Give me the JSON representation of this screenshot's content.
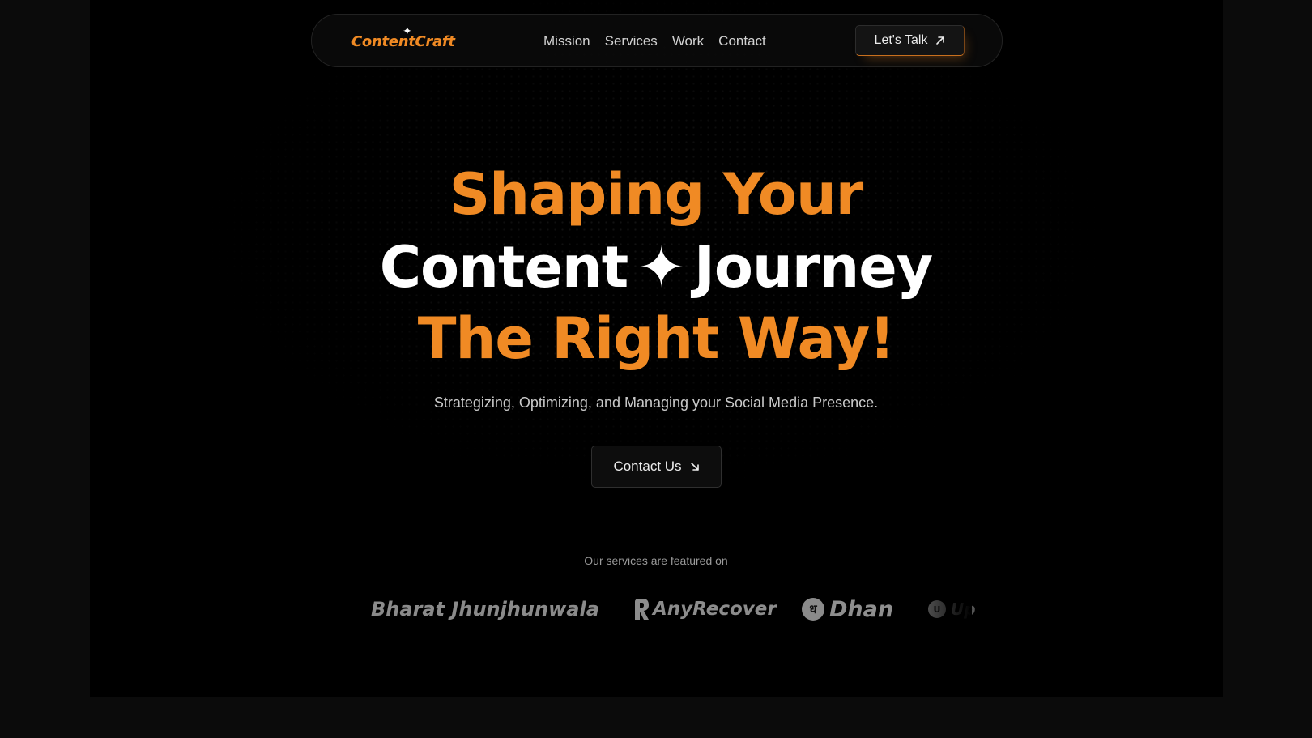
{
  "nav": {
    "logo": "ContentCraft",
    "links": [
      "Mission",
      "Services",
      "Work",
      "Contact"
    ],
    "cta_label": "Let's Talk"
  },
  "hero": {
    "line1": "Shaping Your",
    "line2_left": "Content",
    "line2_sparkle": "✦",
    "line2_right": "Journey",
    "line3": "The Right Way!",
    "subtitle": "Strategizing, Optimizing, and Managing your Social Media Presence.",
    "cta_label": "Contact Us"
  },
  "featured": {
    "label": "Our services are featured on",
    "brands": [
      "Bharat Jhunjhunwala",
      "AnyRecover",
      "Dhan",
      "Up"
    ],
    "dhan_icon_text": "ध",
    "up_icon_text": "U"
  },
  "colors": {
    "accent": "#f08a24",
    "background": "#000000",
    "text": "#ffffff"
  }
}
